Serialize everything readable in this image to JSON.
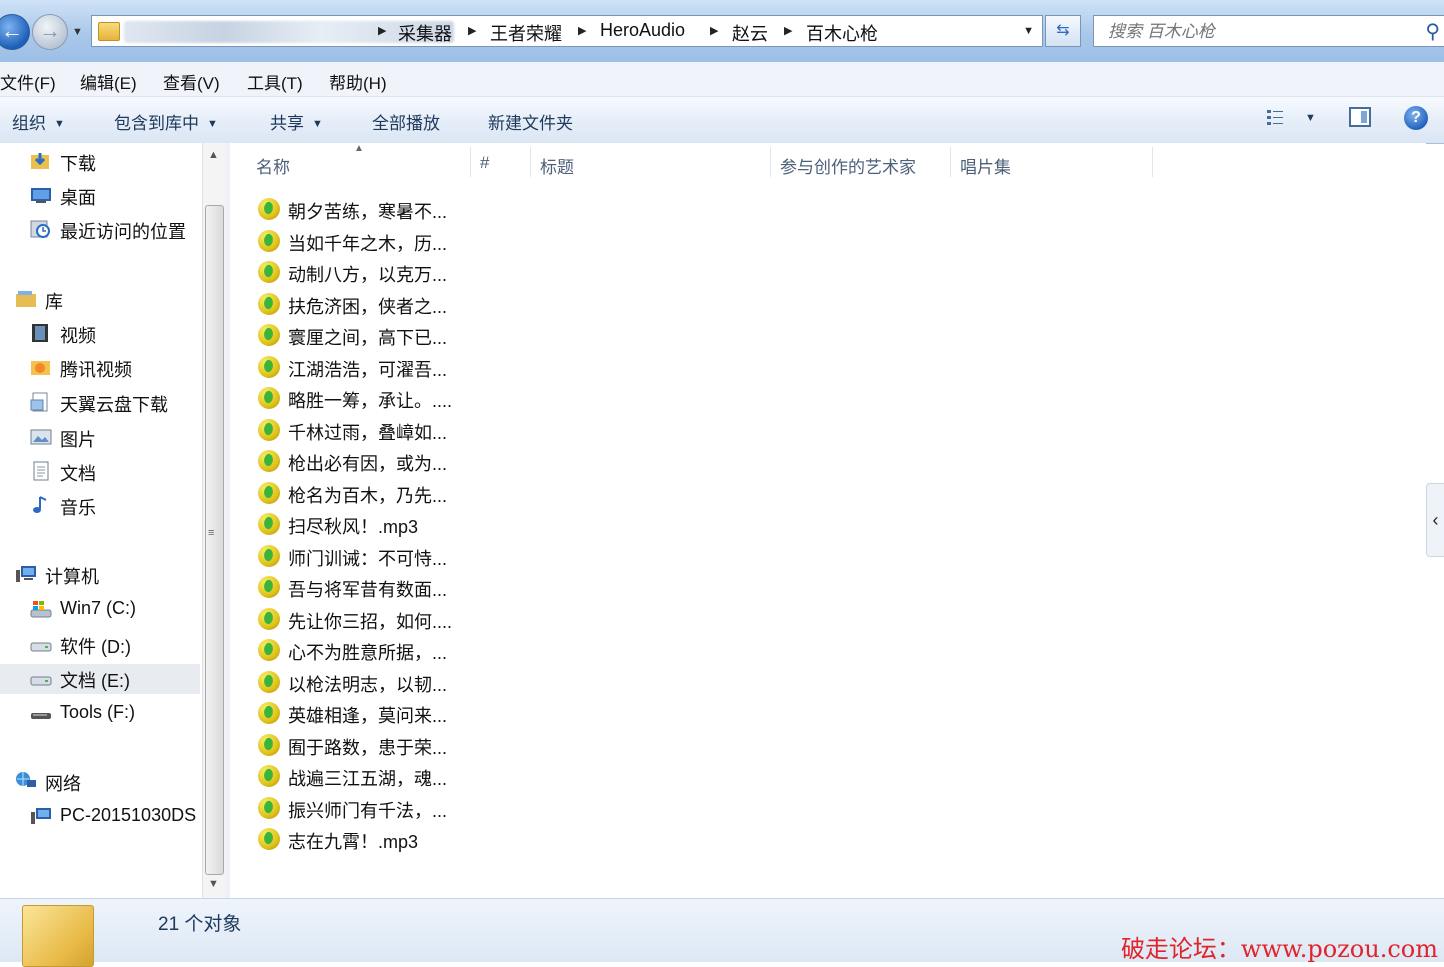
{
  "address": {
    "breadcrumbs": [
      "采集器",
      "王者荣耀",
      "HeroAudio",
      "赵云",
      "百木心枪"
    ],
    "search_placeholder": "搜索 百木心枪"
  },
  "menu": [
    "文件(F)",
    "编辑(E)",
    "查看(V)",
    "工具(T)",
    "帮助(H)"
  ],
  "toolbar": {
    "organize": "组织",
    "include_library": "包含到库中",
    "share": "共享",
    "play_all": "全部播放",
    "new_folder": "新建文件夹"
  },
  "nav": {
    "favorites": [
      "下载",
      "桌面",
      "最近访问的位置"
    ],
    "library_header": "库",
    "libraries": [
      "视频",
      "腾讯视频",
      "天翼云盘下载",
      "图片",
      "文档",
      "音乐"
    ],
    "computer_header": "计算机",
    "drives": [
      "Win7 (C:)",
      "软件 (D:)",
      "文档 (E:)",
      "Tools (F:)"
    ],
    "network_header": "网络",
    "network_items": [
      "PC-20151030DS"
    ]
  },
  "columns": [
    "名称",
    "#",
    "标题",
    "参与创作的艺术家",
    "唱片集"
  ],
  "files": [
    "朝夕苦练，寒暑不...",
    "当如千年之木，历...",
    "动制八方，以克万...",
    "扶危济困，侠者之...",
    "寰厘之间，高下已...",
    "江湖浩浩，可濯吾...",
    "略胜一筹，承让。....",
    "千林过雨，叠嶂如...",
    "枪出必有因，或为...",
    "枪名为百木，乃先...",
    "扫尽秋风！.mp3",
    "师门训诫：不可恃...",
    "吾与将军昔有数面...",
    "先让你三招，如何....",
    "心不为胜意所据，...",
    "以枪法明志，以韧...",
    "英雄相逢，莫问来...",
    "囿于路数，患于荣...",
    "战遍三江五湖，魂...",
    "振兴师门有千法，...",
    "志在九霄！.mp3"
  ],
  "status": {
    "count": "21 个对象"
  },
  "watermark": "破走论坛：www.pozou.com",
  "colors": {
    "accent": "#1d5fb8",
    "watermark": "#e0242a",
    "selected_nav": "#e8ecf1"
  },
  "icons": [
    "back-icon",
    "forward-icon",
    "refresh-icon",
    "search-icon",
    "view-icon",
    "preview-pane-icon",
    "help-icon",
    "music-file-icon"
  ]
}
